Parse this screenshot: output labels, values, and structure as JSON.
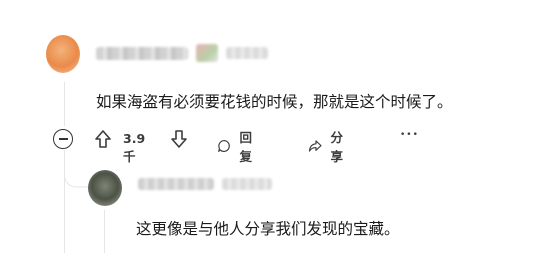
{
  "comment": {
    "body": "如果海盗有必须要花钱的时候，那就是这个时候了。",
    "vote_count": "3.9千",
    "reply_label": "回复",
    "share_label": "分享",
    "more_label": "•••"
  },
  "reply": {
    "body": "这更像是与他人分享我们发现的宝藏。"
  },
  "colors": {
    "text": "#1a1a1b",
    "icon": "#3c3c3c",
    "thread_line": "#e4e6e8"
  },
  "icons": {
    "collapse": "minus-circle-icon",
    "upvote": "arrow-up-icon",
    "downvote": "arrow-down-icon",
    "reply": "speech-bubble-icon",
    "share": "share-arrow-icon",
    "more": "ellipsis-icon"
  }
}
